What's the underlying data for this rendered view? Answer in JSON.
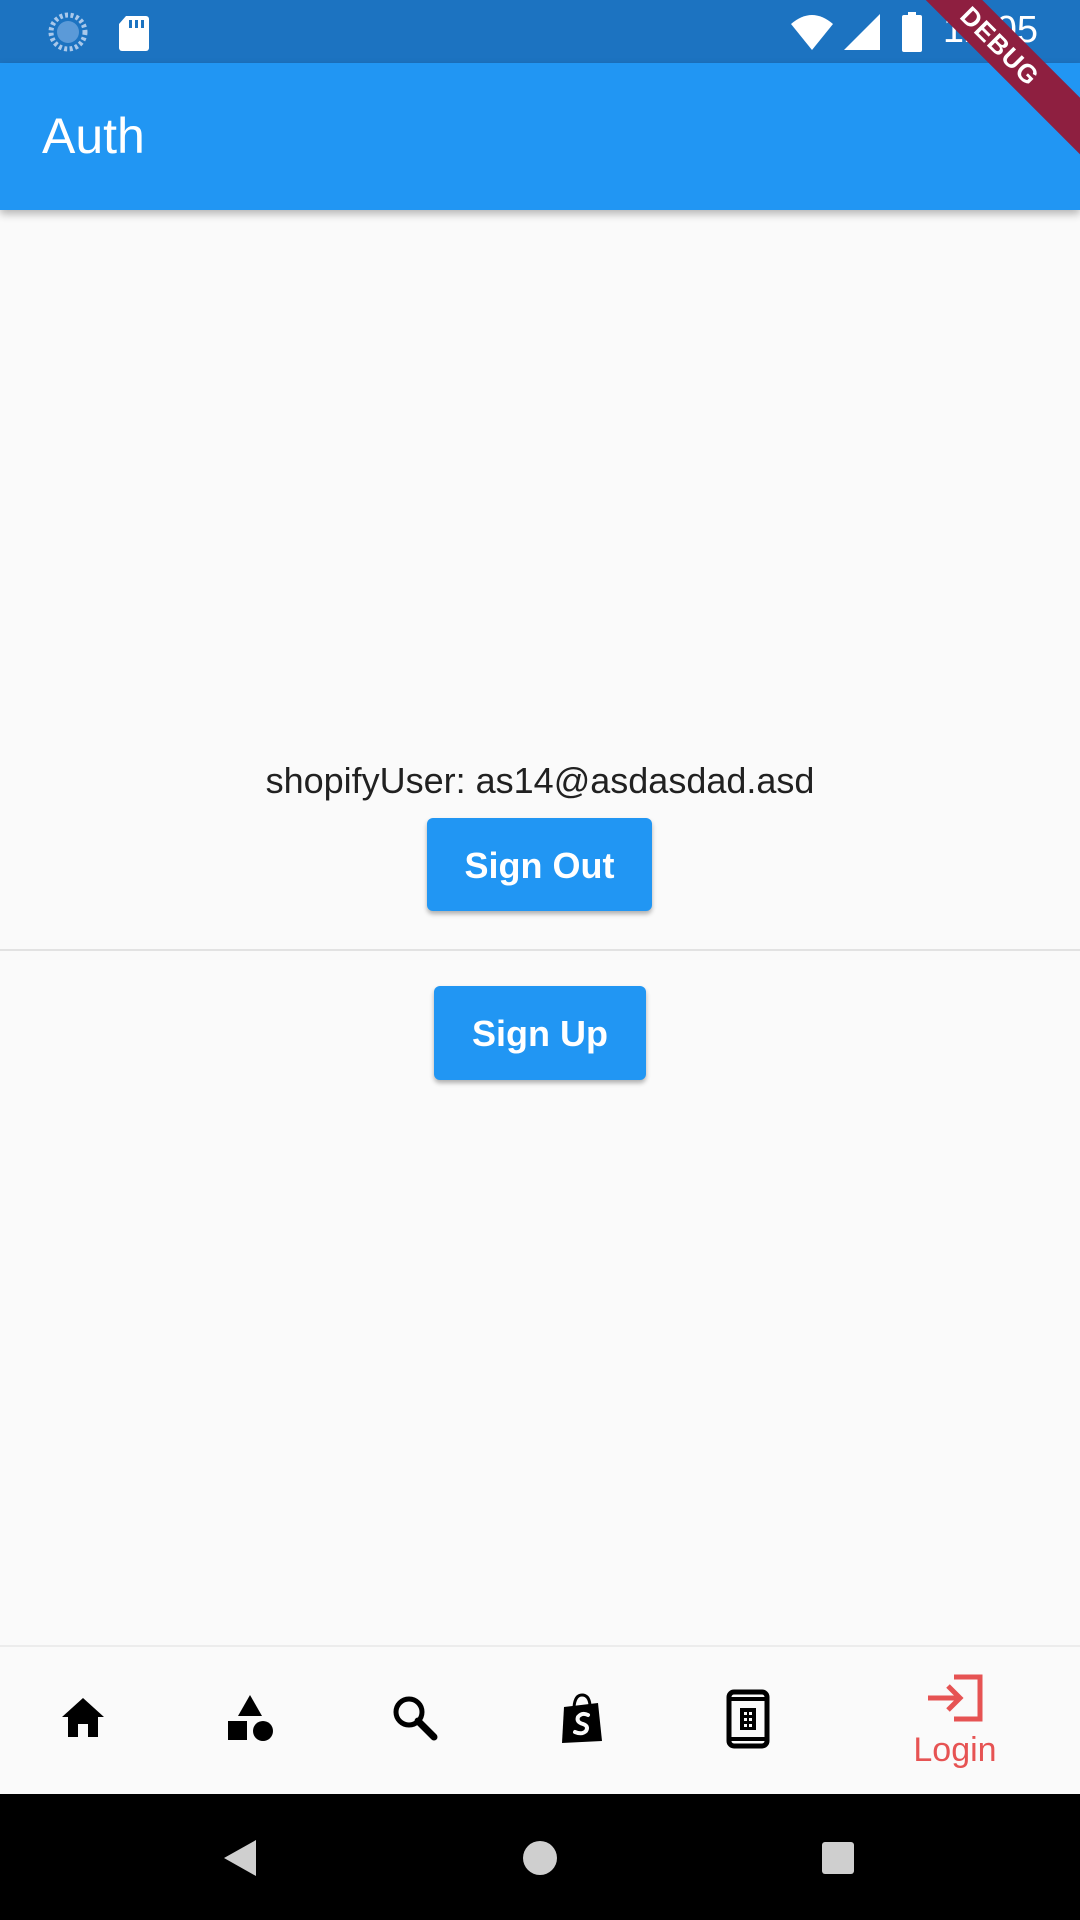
{
  "status_bar": {
    "time": "12:05",
    "icons": [
      "sync-icon",
      "sd-card-icon",
      "wifi-icon",
      "signal-icon",
      "battery-icon"
    ]
  },
  "debug_banner": "DEBUG",
  "app_bar": {
    "title": "Auth"
  },
  "content": {
    "user_info": "shopifyUser: as14@asdasdad.asd",
    "sign_out_label": "Sign Out",
    "sign_up_label": "Sign Up"
  },
  "bottom_nav": {
    "items": [
      {
        "icon": "home-icon"
      },
      {
        "icon": "shapes-icon"
      },
      {
        "icon": "search-icon"
      },
      {
        "icon": "shopify-bag-icon"
      },
      {
        "icon": "phone-book-icon"
      },
      {
        "icon": "login-icon",
        "label": "Login"
      }
    ],
    "active_color": "#e65353"
  },
  "colors": {
    "primary": "#2196f3",
    "status_bar": "#1c73c1",
    "debug": "#8e1f40"
  }
}
